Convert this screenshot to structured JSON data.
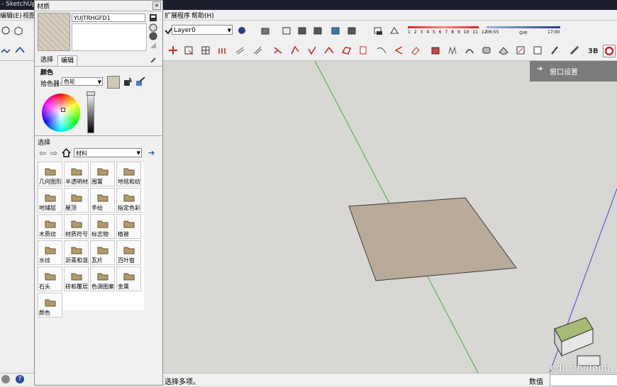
{
  "app": {
    "title_fragment": "- SketchUp"
  },
  "menus": {
    "edit": "编辑(E)",
    "view": "视图",
    "extensions": "扩展程序",
    "help": "帮助(H)"
  },
  "layer_toolbar": {
    "layer_name": "Layer0"
  },
  "shadow_toolbar": {
    "months": [
      "1",
      "2",
      "3",
      "4",
      "5",
      "6",
      "7",
      "8",
      "9",
      "10",
      "11",
      "12"
    ],
    "time_start": "06:55",
    "time_mid": "中午",
    "time_end": "17:00"
  },
  "materials_panel": {
    "title": "材质",
    "close": "×",
    "material_name": "YUJTRHGFD1",
    "tabs": {
      "select": "选择",
      "edit": "编辑"
    },
    "color_heading": "颜色",
    "picker_label": "拾色器:",
    "picker_value": "色轮",
    "browse_heading": "选择",
    "collection": "材料",
    "categories": [
      "几何图形",
      "半透明材",
      "围篱",
      "地毯和纺",
      "地铺层",
      "屋顶",
      "手绘",
      "指定色彩",
      "木质纹",
      "材质符号",
      "标志物",
      "植被",
      "水纹",
      "沥青和混",
      "瓦片",
      "百叶窗",
      "石头",
      "砖和覆层",
      "色调图案",
      "金属",
      "颜色"
    ]
  },
  "window_settings": {
    "label": "窗口设置"
  },
  "status": {
    "message": "选择多项。",
    "measurements_label": "数值"
  },
  "watermark": "edu.zhulong",
  "colors": {
    "accent": "#2a3a8a",
    "plane": "#b9aa99",
    "green_axis": "#3daa3d",
    "blue_axis": "#4545d0"
  }
}
